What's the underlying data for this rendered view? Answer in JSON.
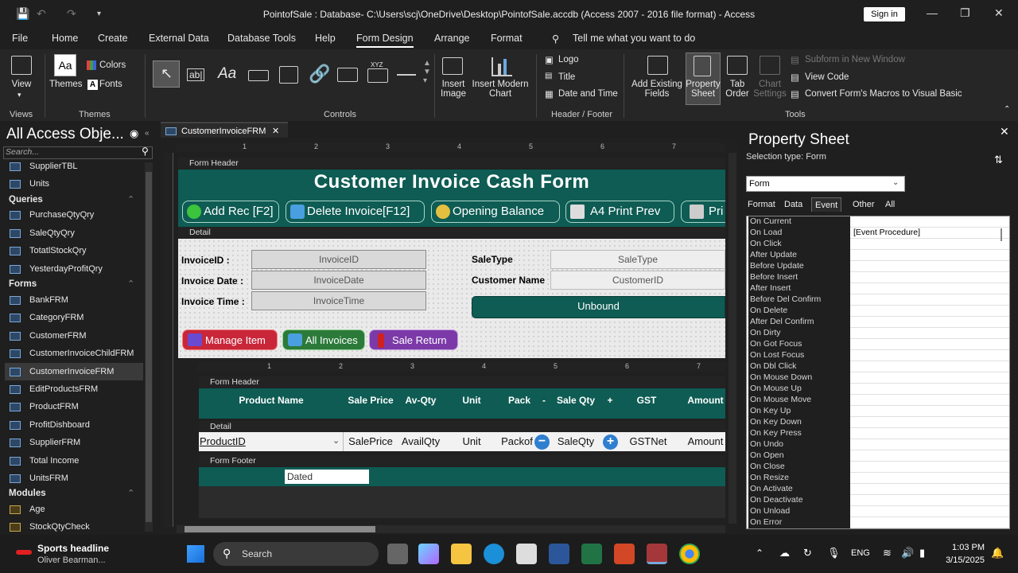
{
  "window": {
    "title": "PointofSale : Database- C:\\Users\\scj\\OneDrive\\Desktop\\PointofSale.accdb (Access 2007 - 2016 file format)  -  Access",
    "signin": "Sign in"
  },
  "tabs": [
    "File",
    "Home",
    "Create",
    "External Data",
    "Database Tools",
    "Help",
    "Form Design",
    "Arrange",
    "Format"
  ],
  "tellme": "Tell me what you want to do",
  "ribbon": {
    "views": {
      "view": "View",
      "group": "Views"
    },
    "themes": {
      "themes": "Themes",
      "colors": "Colors",
      "fonts": "Fonts",
      "group": "Themes"
    },
    "controls": {
      "group": "Controls"
    },
    "insert_image": "Insert Image",
    "insert_chart": "Insert Modern Chart",
    "header_footer": {
      "logo": "Logo",
      "title": "Title",
      "datetime": "Date and Time",
      "group": "Header / Footer"
    },
    "tools": {
      "add_fields": "Add Existing Fields",
      "property_sheet": "Property Sheet",
      "tab_order": "Tab Order",
      "chart_settings": "Chart Settings",
      "subform": "Subform in New Window",
      "view_code": "View Code",
      "convert": "Convert Form's Macros to Visual Basic",
      "group": "Tools"
    }
  },
  "nav": {
    "title": "All Access Obje...",
    "search_placeholder": "Search...",
    "top_items": [
      "SupplierTBL",
      "Units"
    ],
    "queries_label": "Queries",
    "queries": [
      "PurchaseQtyQry",
      "SaleQtyQry",
      "TotatlStockQry",
      "YesterdayProfitQry"
    ],
    "forms_label": "Forms",
    "forms": [
      "BankFRM",
      "CategoryFRM",
      "CustomerFRM",
      "CustomerInvoiceChildFRM",
      "CustomerInvoiceFRM",
      "EditProductsFRM",
      "ProductFRM",
      "ProfitDishboard",
      "SupplierFRM",
      "Total Income",
      "UnitsFRM"
    ],
    "modules_label": "Modules",
    "modules": [
      "Age",
      "StockQtyCheck"
    ]
  },
  "doc": {
    "tab": "CustomerInvoiceFRM",
    "ruler": [
      "1",
      "2",
      "3",
      "4",
      "5",
      "6",
      "7"
    ],
    "form_header": "Form Header",
    "heading": "Customer Invoice Cash Form",
    "header_buttons": [
      "Add Rec [F2]",
      "Delete Invoice[F12]",
      "Opening Balance",
      "A4 Print Prev",
      "Pri"
    ],
    "detail": "Detail",
    "fields": [
      {
        "label": "InvoiceID :",
        "box": "InvoiceID"
      },
      {
        "label": "Invoice Date :",
        "box": "InvoiceDate"
      },
      {
        "label": "Invoice Time :",
        "box": "InvoiceTime"
      }
    ],
    "right_fields": [
      {
        "label": "SaleType",
        "box": "SaleType"
      },
      {
        "label": "Customer Name",
        "box": "CustomerID"
      }
    ],
    "unbound": "Unbound",
    "action_buttons": [
      "Manage Item",
      "All Invoices",
      "Sale Return"
    ],
    "sub": {
      "form_header": "Form Header",
      "columns": [
        "Product Name",
        "Sale Price",
        "Av-Qty",
        "Unit",
        "Pack",
        "-",
        "Sale Qty",
        "+",
        "GST",
        "Amount"
      ],
      "detail": "Detail",
      "cells": [
        "ProductID",
        "SalePrice",
        "AvailQty",
        "Unit",
        "Packof",
        "SaleQty",
        "GSTNet",
        "Amount"
      ],
      "form_footer": "Form Footer",
      "dated": "Dated"
    }
  },
  "props": {
    "title": "Property Sheet",
    "selection_type": "Selection type:  Form",
    "selected": "Form",
    "tabs": [
      "Format",
      "Data",
      "Event",
      "Other",
      "All"
    ],
    "active_tab": "Event",
    "rows": [
      {
        "k": "On Current",
        "v": ""
      },
      {
        "k": "On Load",
        "v": "[Event Procedure]"
      },
      {
        "k": "On Click",
        "v": ""
      },
      {
        "k": "After Update",
        "v": ""
      },
      {
        "k": "Before Update",
        "v": ""
      },
      {
        "k": "Before Insert",
        "v": ""
      },
      {
        "k": "After Insert",
        "v": ""
      },
      {
        "k": "Before Del Confirm",
        "v": ""
      },
      {
        "k": "On Delete",
        "v": ""
      },
      {
        "k": "After Del Confirm",
        "v": ""
      },
      {
        "k": "On Dirty",
        "v": ""
      },
      {
        "k": "On Got Focus",
        "v": ""
      },
      {
        "k": "On Lost Focus",
        "v": ""
      },
      {
        "k": "On Dbl Click",
        "v": ""
      },
      {
        "k": "On Mouse Down",
        "v": ""
      },
      {
        "k": "On Mouse Up",
        "v": ""
      },
      {
        "k": "On Mouse Move",
        "v": ""
      },
      {
        "k": "On Key Up",
        "v": ""
      },
      {
        "k": "On Key Down",
        "v": ""
      },
      {
        "k": "On Key Press",
        "v": ""
      },
      {
        "k": "On Undo",
        "v": ""
      },
      {
        "k": "On Open",
        "v": ""
      },
      {
        "k": "On Close",
        "v": ""
      },
      {
        "k": "On Resize",
        "v": ""
      },
      {
        "k": "On Activate",
        "v": ""
      },
      {
        "k": "On Deactivate",
        "v": ""
      },
      {
        "k": "On Unload",
        "v": ""
      },
      {
        "k": "On Error",
        "v": ""
      }
    ]
  },
  "taskbar": {
    "news_title": "Sports headline",
    "news_sub": "Oliver Bearman...",
    "search": "Search",
    "lang": "ENG",
    "time": "1:03 PM",
    "date": "3/15/2025"
  }
}
